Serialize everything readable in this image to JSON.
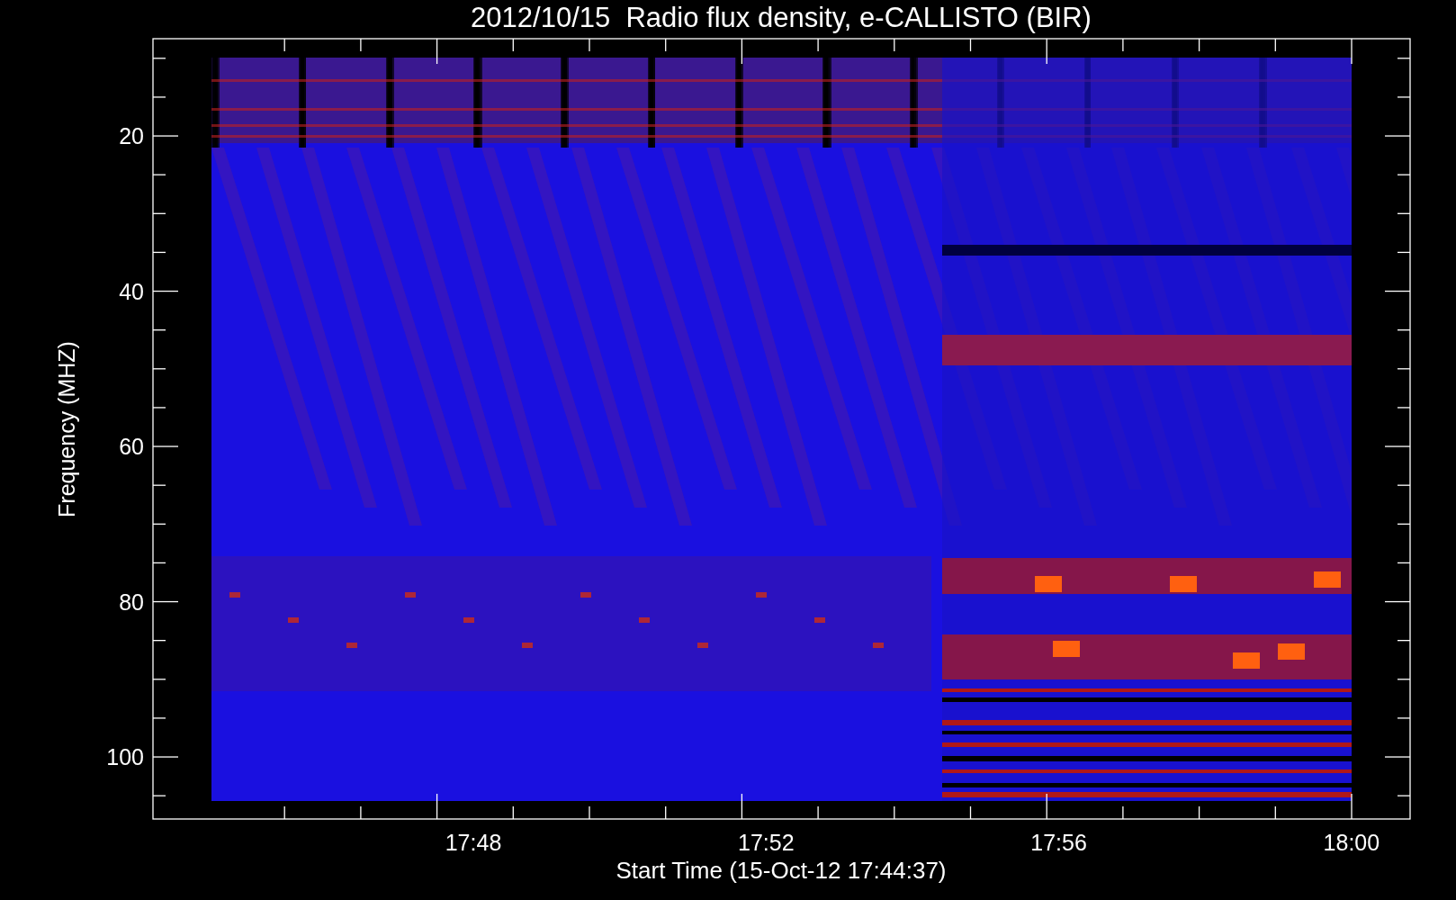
{
  "title": "2012/10/15  Radio flux density, e-CALLISTO (BIR)",
  "y_axis": {
    "label": "Frequency (MHZ)",
    "tick_labels": [
      "20",
      "40",
      "60",
      "80",
      "100"
    ]
  },
  "x_axis": {
    "label": "Start Time (15-Oct-12 17:44:37)",
    "tick_labels": [
      "17:48",
      "17:52",
      "17:56",
      "18:00"
    ]
  }
}
